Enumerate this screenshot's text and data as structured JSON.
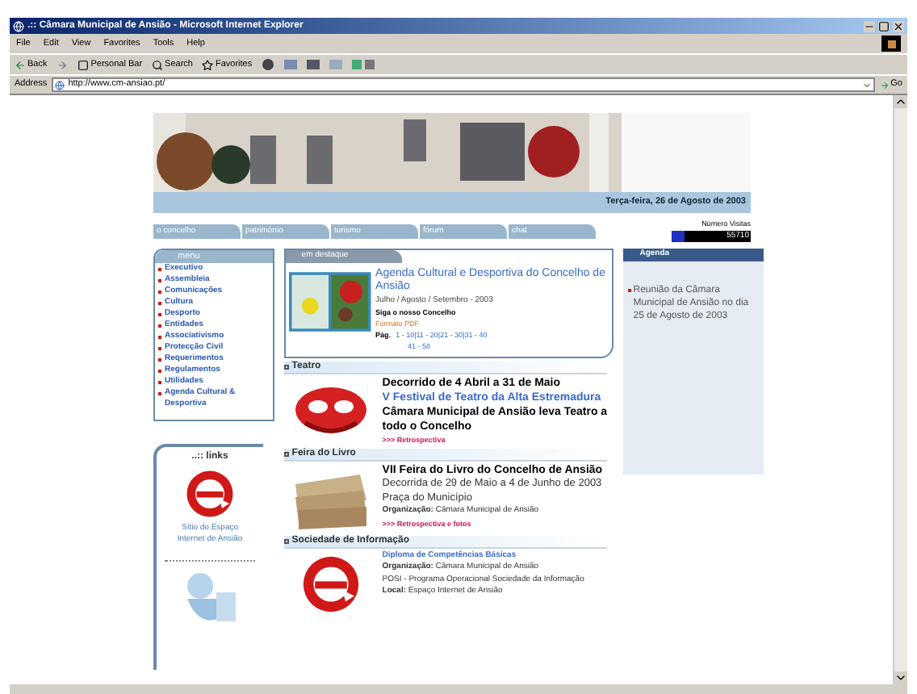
{
  "window": {
    "title": ".:: Câmara Municipal de Ansião - Microsoft Internet Explorer"
  },
  "menu_bar": [
    "File",
    "Edit",
    "View",
    "Favorites",
    "Tools",
    "Help"
  ],
  "toolbar": [
    {
      "kind": "back",
      "label": "Back"
    },
    {
      "kind": "forward"
    },
    {
      "kind": "bar",
      "label": "Personal Bar"
    },
    {
      "kind": "search",
      "label": "Search"
    },
    {
      "kind": "favorites",
      "label": "Favorites"
    }
  ],
  "address": {
    "label": "Address",
    "value": "http://www.cm-ansiao.pt/",
    "go": "Go"
  },
  "page": {
    "date": "Terça-feira, 26 de Agosto de 2003",
    "nav_tabs": [
      "o concelho",
      "património",
      "turismo",
      "fórum",
      "chat"
    ],
    "visitors": {
      "label": "Número Visitas",
      "value": "55710"
    },
    "menu": {
      "title": "menu",
      "items": [
        "Executivo",
        "Assembleia",
        "Comunicações",
        "Cultura",
        "Desporto",
        "Entidades",
        "Associativismo",
        "Protecção Civil",
        "Requerimentos",
        "Regulamentos",
        "Utilidades",
        "Agenda Cultural & Desportiva"
      ]
    },
    "featured": {
      "header": "em destaque",
      "title": "Agenda Cultural e Desportiva do Concelho de Ansião",
      "subtitle": "Julho / Agosto / Setembro - 2003",
      "line": "Siga o nosso Concelho",
      "format": "Formato PDF",
      "pages_label": "Pág.",
      "pages": "1 - 10|11 - 20|21 - 30|31 - 40",
      "pages_more": "41 - 58"
    },
    "agenda": {
      "title": "Agenda",
      "items": [
        "Reunião da Câmara Municipal de Ansião no dia 25 de Agosto de 2003"
      ]
    },
    "sections": [
      {
        "title": "Teatro",
        "lines": [
          {
            "kind": "heading",
            "text": "Decorrido de 4 Abril a 31 de Maio"
          },
          {
            "kind": "highlight",
            "text": "V Festival de Teatro da Alta Estremadura"
          },
          {
            "kind": "heading",
            "text": "Câmara Municipal de Ansião leva Teatro a todo o Concelho"
          },
          {
            "kind": "link",
            "text": ">>> Retrospectiva"
          }
        ]
      },
      {
        "title": "Feira do Livro",
        "lines": [
          {
            "kind": "heading",
            "text": "VII Feira do Livro do Concelho de Ansião"
          },
          {
            "kind": "text",
            "text": "Decorrida de 29 de Maio a 4 de Junho de 2003"
          },
          {
            "kind": "text",
            "text": "Praça do Município"
          },
          {
            "kind": "small",
            "text": "**Organização:** Câmara Municipal de Ansião"
          },
          {
            "kind": "link",
            "text": ">>> Retrospectiva e fotos"
          }
        ]
      },
      {
        "title": "Sociedade de Informação",
        "lines": [
          {
            "kind": "subhead",
            "text": "Diploma de Competências Básicas"
          },
          {
            "kind": "small",
            "text": "**Organização:** Câmara Municipal de Ansião"
          },
          {
            "kind": "small",
            "text": "POSI - Programa Operacional Sociedade da Informação"
          },
          {
            "kind": "small",
            "text": "**Local:** Espaço Internet de Ansião"
          }
        ]
      }
    ],
    "links": {
      "title": "..:: links",
      "caption": "Sítio do Espaço Internet de Ansião"
    }
  }
}
